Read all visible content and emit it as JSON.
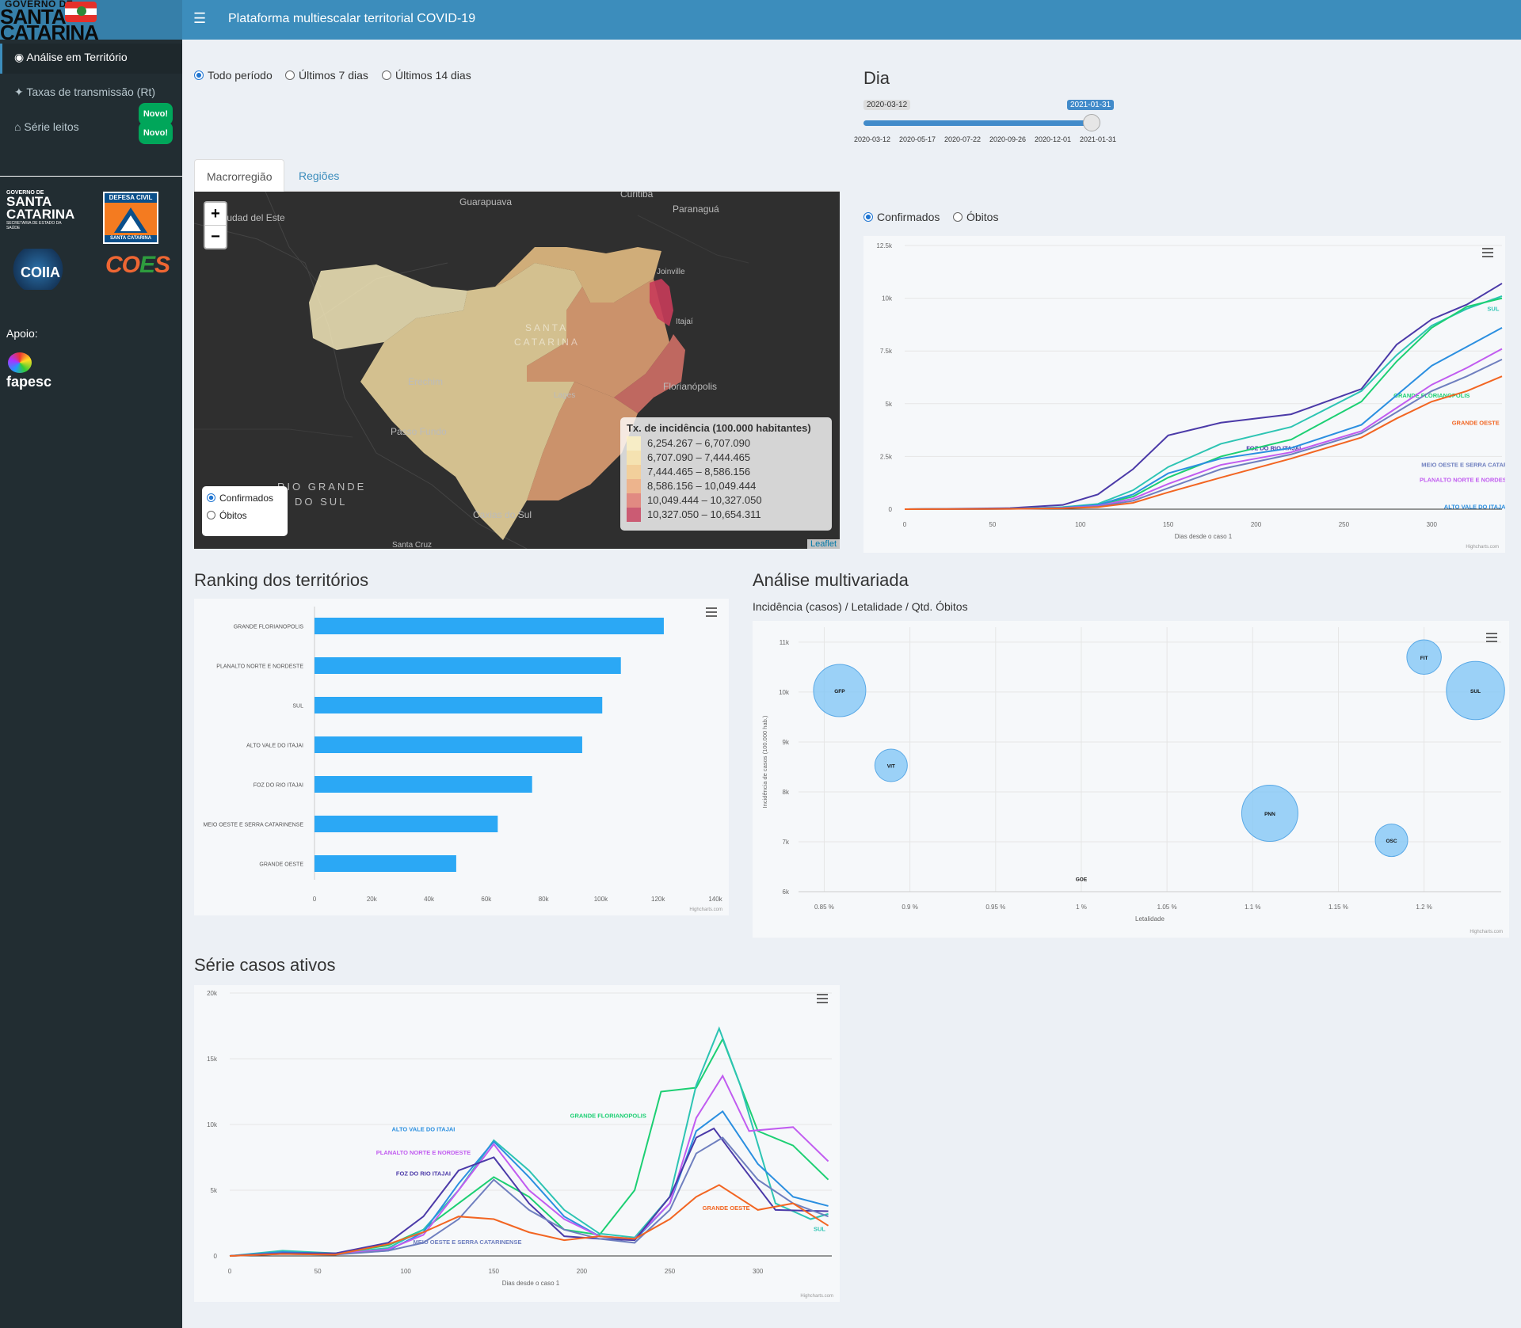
{
  "app": {
    "logo": {
      "line1": "GOVERNO DE",
      "line2": "SANTA",
      "line3": "CATARINA"
    },
    "title": "Plataforma multiescalar territorial COVID-19"
  },
  "sidebar": {
    "items": [
      {
        "label": "Análise em Território",
        "icon": "map-marker-icon"
      },
      {
        "label": "Taxas de transmissão (Rt)",
        "icon": "network-icon",
        "badge": "Novo!"
      },
      {
        "label": "Série leitos",
        "icon": "hospital-icon",
        "badge": "Novo!"
      }
    ],
    "logos": {
      "sc": {
        "a": "GOVERNO DE",
        "b1": "SANTA",
        "b2": "CATARINA",
        "c": "SECRETARIA DE ESTADO DA SAÚDE"
      },
      "defesa": {
        "top": "DEFESA CIVIL",
        "bottom": "SANTA CATARINA"
      },
      "coiia": "COIIA",
      "coes_c": "CO",
      "coes_e": "E",
      "coes_s": "S"
    },
    "apoio_label": "Apoio:",
    "fapesc": "fapesc"
  },
  "period": {
    "options": [
      "Todo período",
      "Últimos 7 dias",
      "Últimos 14 dias"
    ],
    "selected": 0
  },
  "day_slider": {
    "title": "Dia",
    "min_label": "2020-03-12",
    "value_label": "2021-01-31",
    "ticks": [
      "2020-03-12",
      "2020-05-17",
      "2020-07-22",
      "2020-09-26",
      "2020-12-01",
      "2021-01-31"
    ],
    "value_fraction": 1.0
  },
  "tabs": [
    "Macrorregião",
    "Regiões"
  ],
  "map": {
    "zoom_in": "+",
    "zoom_out": "−",
    "cities": [
      "Guarapuava",
      "Ciudad del Este",
      "Curitiba",
      "Paranaguá",
      "Joinville",
      "Itajaí",
      "Florianópolis",
      "Erechim",
      "Lages",
      "Passo Fundo",
      "RIO GRANDE",
      "DO SUL",
      "Caxias do Sul",
      "Santa Cruz",
      "SANTA",
      "CATARINA"
    ],
    "legend_title": "Tx. de incidência (100.000 habitantes)",
    "legend": [
      {
        "label": "6,254.267 – 6,707.090",
        "color": "#fff3c2"
      },
      {
        "label": "6,707.090 – 7,444.465",
        "color": "#fde5a8"
      },
      {
        "label": "7,444.465 – 8,586.156",
        "color": "#f9cd8c"
      },
      {
        "label": "8,586.156 – 10,049.444",
        "color": "#f2ab7a"
      },
      {
        "label": "10,049.444 – 10,327.050",
        "color": "#e3776d"
      },
      {
        "label": "10,327.050 – 10,654.311",
        "color": "#c83c5a"
      }
    ],
    "radio": [
      "Confirmados",
      "Óbitos"
    ],
    "attribution": "Leaflet"
  },
  "cases_radio": [
    "Confirmados",
    "Óbitos"
  ],
  "ranking": {
    "title": "Ranking dos territórios"
  },
  "multivariate": {
    "title": "Análise multivariada",
    "subtitle": "Incidência (casos) / Letalidade / Qtd. Óbitos"
  },
  "active": {
    "title": "Série casos ativos"
  },
  "credits": "Highcharts.com",
  "chart_data": [
    {
      "type": "line",
      "name": "cumulative_cases",
      "xlabel": "Dias desde o caso 1",
      "ylabel": "",
      "xlim": [
        0,
        340
      ],
      "ylim": [
        0,
        12500
      ],
      "xticks": [
        0,
        50,
        100,
        150,
        200,
        250,
        300
      ],
      "yticks": [
        "0",
        "2.5k",
        "5k",
        "7.5k",
        "10k",
        "12.5k"
      ],
      "series": [
        {
          "name": "FOZ DO RIO ITAJAI",
          "color": "#4b3aa8",
          "x": [
            0,
            60,
            90,
            110,
            130,
            150,
            180,
            220,
            260,
            280,
            300,
            320,
            340
          ],
          "values": [
            0,
            50,
            200,
            700,
            1900,
            3500,
            4100,
            4500,
            5700,
            7800,
            9000,
            9700,
            10700
          ]
        },
        {
          "name": "SUL",
          "color": "#2dc4b3",
          "x": [
            0,
            60,
            90,
            110,
            130,
            150,
            180,
            220,
            260,
            280,
            300,
            320,
            340
          ],
          "values": [
            0,
            20,
            100,
            250,
            900,
            2000,
            3100,
            3900,
            5600,
            7300,
            8700,
            9500,
            10100
          ]
        },
        {
          "name": "GRANDE FLORIANOPOLIS",
          "color": "#1ccf73",
          "x": [
            0,
            60,
            90,
            110,
            130,
            150,
            180,
            220,
            260,
            280,
            300,
            320,
            340
          ],
          "values": [
            0,
            20,
            80,
            200,
            600,
            1500,
            2500,
            3300,
            5100,
            7000,
            8600,
            9600,
            10000
          ]
        },
        {
          "name": "ALTO VALE DO ITAJAI",
          "color": "#2b8fe0",
          "x": [
            0,
            60,
            90,
            110,
            130,
            150,
            180,
            220,
            260,
            280,
            300,
            320,
            340
          ],
          "values": [
            0,
            20,
            80,
            200,
            700,
            1700,
            2400,
            2900,
            4000,
            5400,
            6800,
            7700,
            8600
          ]
        },
        {
          "name": "PLANALTO NORTE E NORDESTE",
          "color": "#c15cf0",
          "x": [
            0,
            60,
            90,
            110,
            130,
            150,
            180,
            220,
            260,
            280,
            300,
            320,
            340
          ],
          "values": [
            0,
            20,
            60,
            150,
            500,
            1200,
            2100,
            2700,
            3700,
            4800,
            5900,
            6700,
            7600
          ]
        },
        {
          "name": "MEIO OESTE E SERRA CATARINENSE",
          "color": "#6f7fbf",
          "x": [
            0,
            60,
            90,
            110,
            130,
            150,
            180,
            220,
            260,
            280,
            300,
            320,
            340
          ],
          "values": [
            0,
            15,
            50,
            120,
            400,
            1000,
            1900,
            2600,
            3600,
            4600,
            5600,
            6300,
            7100
          ]
        },
        {
          "name": "GRANDE OESTE",
          "color": "#f26522",
          "x": [
            0,
            60,
            90,
            110,
            130,
            150,
            180,
            220,
            260,
            280,
            300,
            320,
            340
          ],
          "values": [
            0,
            15,
            40,
            100,
            300,
            800,
            1500,
            2400,
            3400,
            4300,
            5100,
            5600,
            6300
          ]
        }
      ]
    },
    {
      "type": "bar",
      "name": "ranking",
      "categories": [
        "GRANDE FLORIANOPOLIS",
        "PLANALTO NORTE E NORDESTE",
        "SUL",
        "ALTO VALE DO ITAJAI",
        "FOZ DO RIO ITAJAI",
        "MEIO OESTE E SERRA CATARINENSE",
        "GRANDE OESTE"
      ],
      "values": [
        122000,
        107000,
        100500,
        93500,
        76000,
        64000,
        49500
      ],
      "xticks": [
        "0",
        "20k",
        "40k",
        "60k",
        "80k",
        "100k",
        "120k",
        "140k"
      ],
      "xlim": [
        0,
        140000
      ],
      "color": "#2ba8f5"
    },
    {
      "type": "scatter",
      "name": "bubble",
      "xlabel": "Letalidade",
      "ylabel": "Incidência de casos (100.000 hab.)",
      "xlim": [
        0.835,
        1.245
      ],
      "ylim": [
        6000,
        11300
      ],
      "xticks": [
        "0.85 %",
        "0.9 %",
        "0.95 %",
        "1 %",
        "1.05 %",
        "1.1 %",
        "1.15 %",
        "1.2 %"
      ],
      "yticks": [
        "6k",
        "7k",
        "8k",
        "9k",
        "10k",
        "11k"
      ],
      "points": [
        {
          "label": "GFP",
          "x": 0.859,
          "y": 10030,
          "r": 1.0
        },
        {
          "label": "VIT",
          "x": 0.889,
          "y": 8530,
          "r": 0.5
        },
        {
          "label": "GOE",
          "x": 1.0,
          "y": 6260,
          "r": 0.0
        },
        {
          "label": "PNN",
          "x": 1.11,
          "y": 7570,
          "r": 1.1
        },
        {
          "label": "OSC",
          "x": 1.181,
          "y": 7030,
          "r": 0.5
        },
        {
          "label": "FIT",
          "x": 1.2,
          "y": 10700,
          "r": 0.55
        },
        {
          "label": "SUL",
          "x": 1.23,
          "y": 10030,
          "r": 1.15
        }
      ]
    },
    {
      "type": "line",
      "name": "active_cases",
      "xlabel": "Dias desde o caso 1",
      "xlim": [
        0,
        342
      ],
      "ylim": [
        0,
        20000
      ],
      "xticks": [
        0,
        50,
        100,
        150,
        200,
        250,
        300
      ],
      "yticks": [
        "0",
        "5k",
        "10k",
        "15k",
        "20k"
      ],
      "series": [
        {
          "name": "GRANDE FLORIANOPOLIS",
          "color": "#1ccf73",
          "x": [
            0,
            30,
            60,
            90,
            110,
            130,
            150,
            170,
            190,
            210,
            230,
            245,
            265,
            280,
            300,
            320,
            340
          ],
          "values": [
            0,
            300,
            200,
            800,
            2000,
            4000,
            6000,
            4500,
            2000,
            1600,
            5000,
            12500,
            12800,
            16500,
            9500,
            8400,
            5800
          ]
        },
        {
          "name": "SUL",
          "color": "#2dc4b3",
          "x": [
            0,
            30,
            60,
            90,
            110,
            130,
            150,
            170,
            190,
            210,
            230,
            250,
            265,
            278,
            290,
            310,
            330,
            340
          ],
          "values": [
            0,
            400,
            200,
            600,
            2000,
            5000,
            8800,
            6500,
            3500,
            1700,
            1400,
            4500,
            13000,
            17300,
            13000,
            4000,
            2800,
            3200
          ]
        },
        {
          "name": "ALTO VALE DO ITAJAI",
          "color": "#2b8fe0",
          "x": [
            0,
            30,
            60,
            90,
            110,
            130,
            150,
            170,
            190,
            210,
            230,
            250,
            265,
            280,
            300,
            320,
            340
          ],
          "values": [
            0,
            300,
            150,
            400,
            1800,
            5500,
            8700,
            6000,
            3000,
            1500,
            1200,
            4000,
            9500,
            11000,
            7000,
            4500,
            3800
          ]
        },
        {
          "name": "PLANALTO NORTE E NORDESTE",
          "color": "#c15cf0",
          "x": [
            0,
            30,
            60,
            90,
            110,
            130,
            150,
            170,
            190,
            210,
            230,
            250,
            265,
            280,
            295,
            320,
            340
          ],
          "values": [
            0,
            200,
            150,
            500,
            1600,
            5000,
            8500,
            5000,
            2800,
            1500,
            1300,
            4000,
            10500,
            13700,
            9500,
            9800,
            7200
          ]
        },
        {
          "name": "FOZ DO RIO ITAJAI",
          "color": "#4b3aa8",
          "x": [
            0,
            30,
            60,
            90,
            110,
            130,
            150,
            170,
            190,
            210,
            230,
            250,
            265,
            275,
            290,
            310,
            340
          ],
          "values": [
            0,
            200,
            200,
            1000,
            3000,
            6500,
            7500,
            4000,
            1500,
            1300,
            1200,
            4500,
            9000,
            9700,
            7000,
            3500,
            3400
          ]
        },
        {
          "name": "MEIO OESTE E SERRA CATARINENSE",
          "color": "#6f7fbf",
          "x": [
            0,
            30,
            60,
            90,
            110,
            130,
            150,
            170,
            190,
            210,
            230,
            250,
            265,
            280,
            300,
            320,
            340
          ],
          "values": [
            0,
            150,
            100,
            400,
            1000,
            2800,
            5800,
            3500,
            2000,
            1300,
            1000,
            3500,
            7800,
            9000,
            5800,
            4000,
            3000
          ]
        },
        {
          "name": "GRANDE OESTE",
          "color": "#f26522",
          "x": [
            0,
            30,
            60,
            90,
            110,
            130,
            150,
            170,
            190,
            210,
            230,
            250,
            265,
            278,
            300,
            320,
            340
          ],
          "values": [
            0,
            150,
            100,
            900,
            1800,
            3000,
            2800,
            1800,
            1200,
            1500,
            1300,
            2800,
            4500,
            5400,
            3500,
            4000,
            2300
          ]
        }
      ]
    }
  ]
}
